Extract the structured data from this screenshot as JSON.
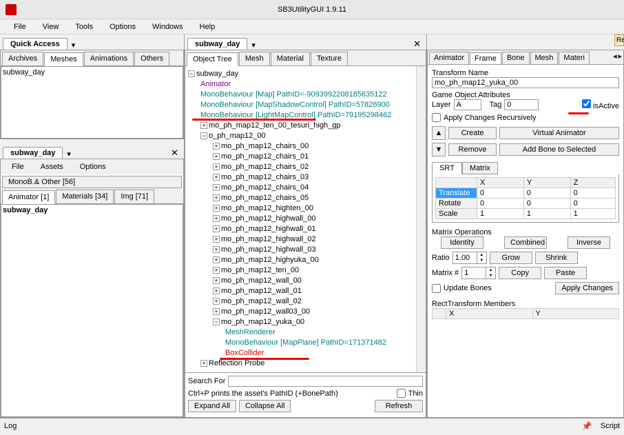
{
  "title": "SB3UtilityGUI 1.9.11",
  "menubar": [
    "File",
    "View",
    "Tools",
    "Options",
    "Windows",
    "Help"
  ],
  "quickAccess": {
    "title": "Quick Access",
    "tabs": [
      "Archives",
      "Meshes",
      "Animations",
      "Others"
    ],
    "activeTab": 1,
    "items": [
      "subway_day"
    ]
  },
  "assetPanel": {
    "title": "subway_day",
    "menubar": [
      "File",
      "Assets",
      "Options"
    ],
    "filterLabel": "MonoB.& Other [56]",
    "tabs": [
      "Animator [1]",
      "Materials [34]",
      "Img [71]"
    ],
    "activeTab": 0,
    "items": [
      "subway_day"
    ]
  },
  "midPanel": {
    "title": "subway_day",
    "tabs": [
      "Object Tree",
      "Mesh",
      "Material",
      "Texture"
    ],
    "activeTab": 0,
    "tree": {
      "root": "subway_day",
      "animator": "Animator",
      "mono1": "MonoBehaviour [Map] PathID=-9093992208185635122",
      "mono2": "MonoBehaviour [MapShadowControl] PathID=57826900",
      "mono3": "MonoBehaviour [LightMapControl] PathID=79195298462",
      "tesuri": "mo_ph_map12_ten_00_tesuri_high_gp",
      "o_ph": "o_ph_map12_00",
      "children": [
        "mo_ph_map12_chairs_00",
        "mo_ph_map12_chairs_01",
        "mo_ph_map12_chairs_02",
        "mo_ph_map12_chairs_03",
        "mo_ph_map12_chairs_04",
        "mo_ph_map12_chairs_05",
        "mo_ph_map12_highten_00",
        "mo_ph_map12_highwall_00",
        "mo_ph_map12_highwall_01",
        "mo_ph_map12_highwall_02",
        "mo_ph_map12_highwall_03",
        "mo_ph_map12_highyuka_00",
        "mo_ph_map12_ten_00",
        "mo_ph_map12_wall_00",
        "mo_ph_map12_wall_01",
        "mo_ph_map12_wall_02",
        "mo_ph_map12_wall03_00",
        "mo_ph_map12_yuka_00"
      ],
      "yuka_children": {
        "mesh": "MeshRenderer",
        "mono": "MonoBehaviour [MapPlane] PathID=171371482",
        "box": "BoxCollider"
      },
      "reflection": "Reflection Probe"
    },
    "search": {
      "label": "Search For",
      "hint": "Ctrl+P prints the asset's PathID (+BonePath)",
      "thin": "Thin",
      "expandAll": "Expand All",
      "collapseAll": "Collapse All",
      "refresh": "Refresh"
    }
  },
  "rightPanel": {
    "tabs": [
      "Animator",
      "Frame",
      "Bone",
      "Mesh",
      "Materi"
    ],
    "activeTab": 1,
    "transformName": {
      "label": "Transform Name",
      "value": "mo_ph_map12_yuka_00"
    },
    "gameObj": {
      "label": "Game Object Attributes",
      "layerLabel": "Layer",
      "layerValue": "A",
      "tagLabel": "Tag",
      "tagValue": "0",
      "isActiveLabel": "isActive",
      "isActive": true
    },
    "applyRecursive": {
      "label": "Apply Changes Recursively",
      "checked": false
    },
    "buttons": {
      "create": "Create",
      "virtualAnim": "Virtual Animator",
      "remove": "Remove",
      "addBone": "Add Bone to Selected"
    },
    "srtTabs": [
      "SRT",
      "Matrix"
    ],
    "gridHeaders": [
      "X",
      "Y",
      "Z"
    ],
    "gridRows": [
      {
        "name": "Translate",
        "x": "0",
        "y": "0",
        "z": "0",
        "selected": true
      },
      {
        "name": "Rotate",
        "x": "0",
        "y": "0",
        "z": "0"
      },
      {
        "name": "Scale",
        "x": "1",
        "y": "1",
        "z": "1"
      }
    ],
    "matrixOps": {
      "label": "Matrix Operations",
      "identity": "Identity",
      "combined": "Combined",
      "inverse": "Inverse",
      "ratioLabel": "Ratio",
      "ratioValue": "1.00",
      "grow": "Grow",
      "shrink": "Shrink",
      "matrixNumLabel": "Matrix #",
      "matrixNumValue": "1",
      "copy": "Copy",
      "paste": "Paste"
    },
    "updateBones": {
      "label": "Update Bones",
      "checked": false,
      "apply": "Apply Changes"
    },
    "rectTransform": {
      "label": "RectTransform Members",
      "headers": [
        "X",
        "Y"
      ]
    }
  },
  "statusbar": {
    "log": "Log",
    "script": "Script"
  }
}
